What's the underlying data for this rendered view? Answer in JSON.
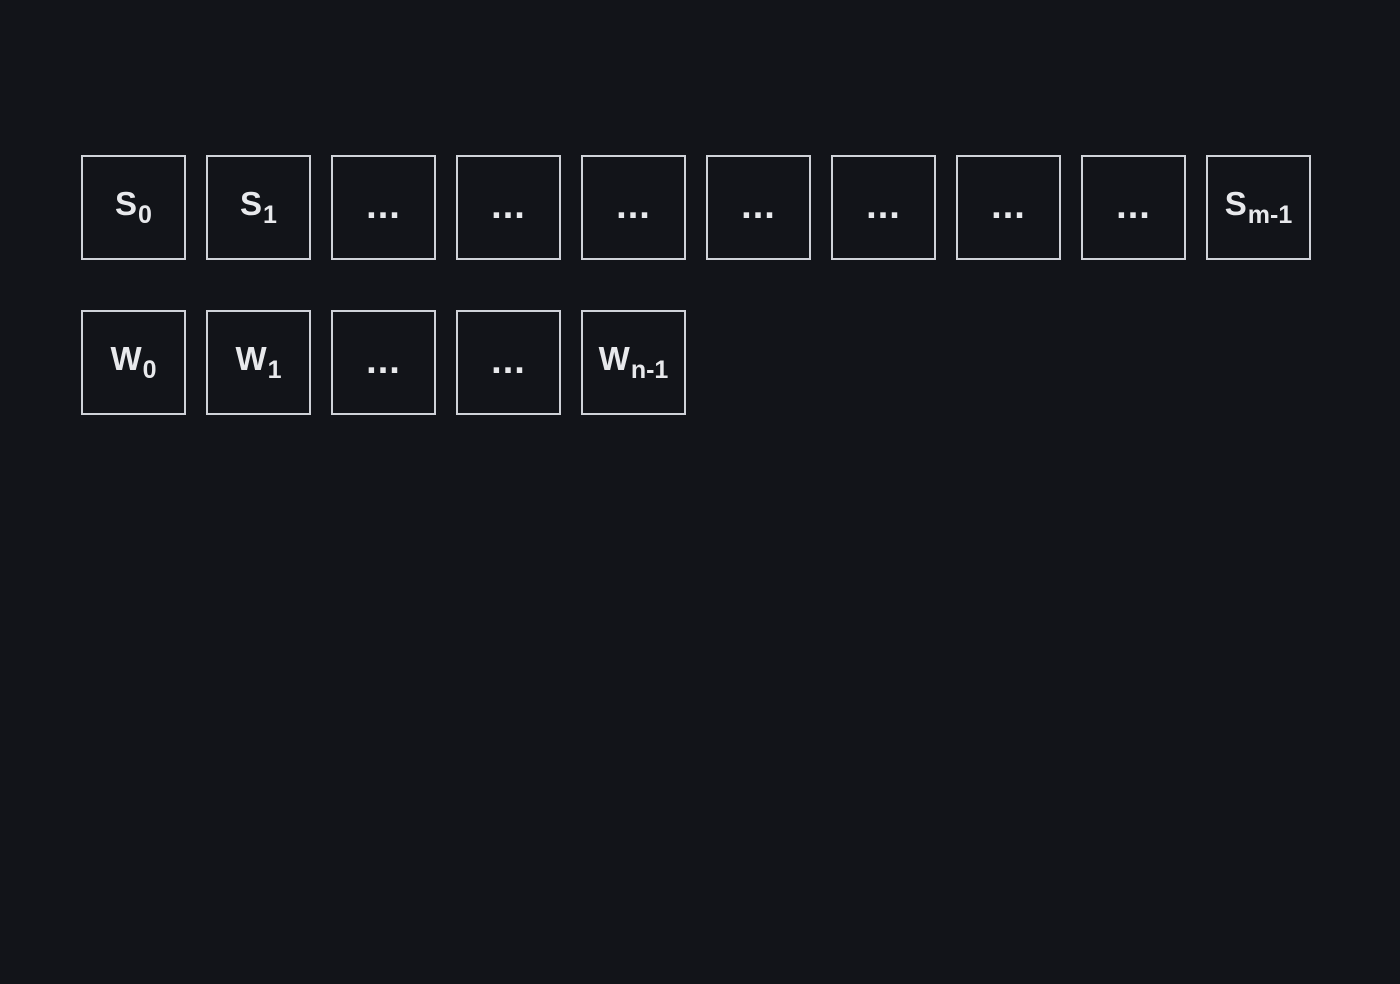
{
  "rows": [
    {
      "id": "s",
      "cells": [
        {
          "symbol": "S",
          "subscript": "0"
        },
        {
          "symbol": "S",
          "subscript": "1"
        },
        {
          "ellipsis": "..."
        },
        {
          "ellipsis": "..."
        },
        {
          "ellipsis": "..."
        },
        {
          "ellipsis": "..."
        },
        {
          "ellipsis": "..."
        },
        {
          "ellipsis": "..."
        },
        {
          "ellipsis": "..."
        },
        {
          "symbol": "S",
          "subscript": "m-1"
        }
      ]
    },
    {
      "id": "w",
      "cells": [
        {
          "symbol": "W",
          "subscript": "0"
        },
        {
          "symbol": "W",
          "subscript": "1"
        },
        {
          "ellipsis": "..."
        },
        {
          "ellipsis": "..."
        },
        {
          "symbol": "W",
          "subscript": "n-1"
        }
      ]
    }
  ],
  "colors": {
    "background": "#121419",
    "box_border": "#cfd2d8",
    "text": "#e8e9ec"
  }
}
